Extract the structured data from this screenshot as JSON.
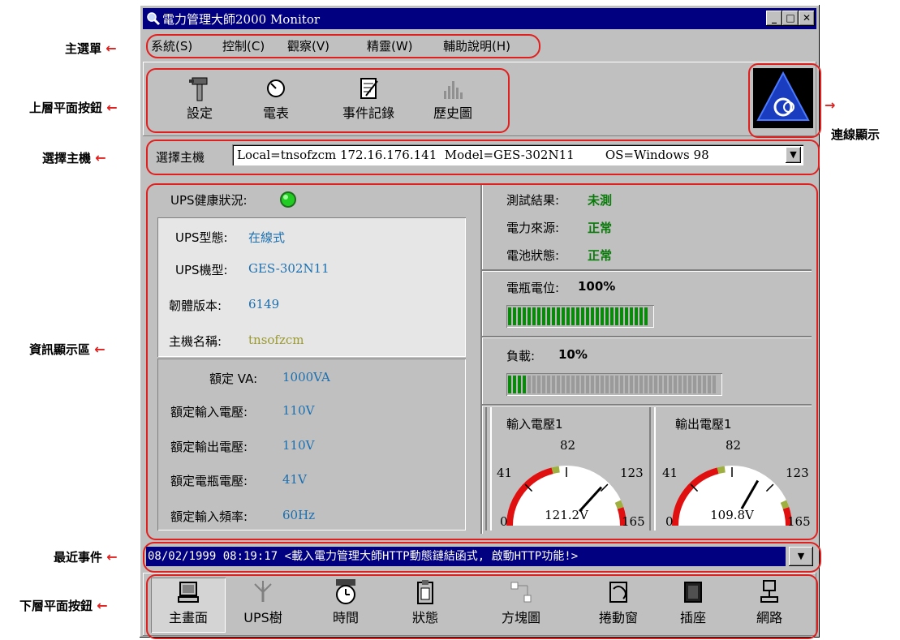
{
  "window": {
    "title": "電力管理大師2000 Monitor",
    "minimize": "_",
    "maximize": "□",
    "close": "✕"
  },
  "menu": [
    "系統(S)",
    "控制(C)",
    "觀察(V)",
    "精靈(W)",
    "輔助說明(H)"
  ],
  "top_toolbar": [
    "設定",
    "電表",
    "事件記錄",
    "歷史圖"
  ],
  "host_select": {
    "label": "選擇主機",
    "value": "Local=tnsofzcm 172.16.176.141  Model=GES-302N11        OS=Windows 98"
  },
  "status": {
    "health_label": "UPS健康狀況:",
    "health_color": "#22cc22",
    "test_label": "測試結果:",
    "test_value": "未測",
    "source_label": "電力來源:",
    "source_value": "正常",
    "battery_label": "電池狀態:",
    "battery_value": "正常"
  },
  "info": {
    "type_label": "UPS型態:",
    "type_value": "在線式",
    "model_label": "UPS機型:",
    "model_value": "GES-302N11",
    "firmware_label": "韌體版本:",
    "firmware_value": "6149",
    "host_label": "主機名稱:",
    "host_value": "tnsofzcm"
  },
  "rated": {
    "va_label": "額定 VA:",
    "va_value": "1000VA",
    "in_v_label": "額定輸入電壓:",
    "in_v_value": "110V",
    "out_v_label": "額定輸出電壓:",
    "out_v_value": "110V",
    "batt_v_label": "額定電瓶電壓:",
    "batt_v_value": "41V",
    "freq_label": "額定輸入頻率:",
    "freq_value": "60Hz"
  },
  "battery_level": {
    "label": "電瓶電位:",
    "text": "100%",
    "percent": 100
  },
  "load": {
    "label": "負載:",
    "text": "10%",
    "percent": 10
  },
  "gauges": [
    {
      "title": "輸入電壓1",
      "ticks": [
        "0",
        "41",
        "82",
        "123",
        "165"
      ],
      "reading": "121.2V",
      "value": 121.2,
      "max": 165
    },
    {
      "title": "輸出電壓1",
      "ticks": [
        "0",
        "41",
        "82",
        "123",
        "165"
      ],
      "reading": "109.8V",
      "value": 109.8,
      "max": 165
    }
  ],
  "recent_event": "08/02/1999 08:19:17  <載入電力管理大師HTTP動態鏈結函式, 啟動HTTP功能!>",
  "bottom_toolbar": [
    "主畫面",
    "UPS樹",
    "時間",
    "狀態",
    "方塊圖",
    "捲動窗",
    "插座",
    "網路"
  ],
  "annotations": {
    "main_menu": "主選單",
    "top_buttons": "上層平面按鈕",
    "select_host": "選擇主機",
    "info_area": "資訊顯示區",
    "recent_event": "最近事件",
    "bottom_buttons": "下層平面按鈕",
    "connection": "連線顯示"
  },
  "colors": {
    "accent_red": "#e0201e",
    "title_bar": "#000080",
    "bar_green": "#0a8a0a"
  }
}
